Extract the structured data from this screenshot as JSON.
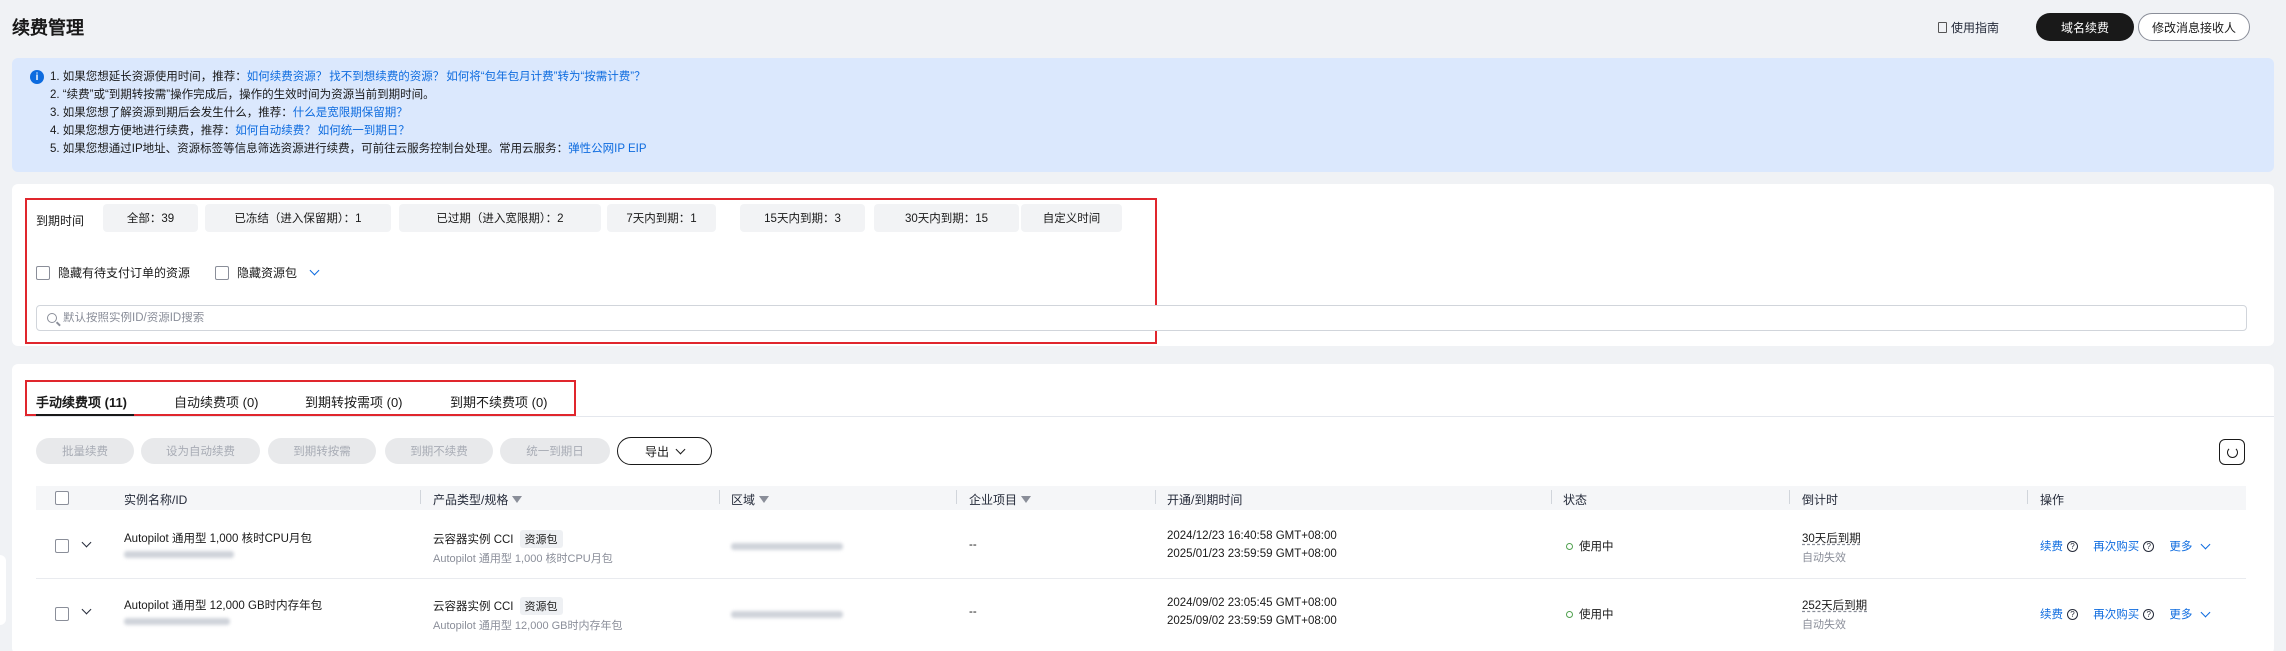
{
  "header": {
    "title": "续费管理",
    "guide_label": "使用指南",
    "primary_button": "域名续费",
    "outline_button": "修改消息接收人"
  },
  "notice": {
    "lines": [
      {
        "prefix": "1. 如果您想延长资源使用时间，推荐：",
        "links": [
          "如何续费资源？",
          "找不到想续费的资源？",
          "如何将“包年包月计费”转为“按需计费”？"
        ],
        "suffix": ""
      },
      {
        "prefix": "2. “续费”或“到期转按需”操作完成后，操作的生效时间为资源当前到期时间。",
        "links": [],
        "suffix": ""
      },
      {
        "prefix": "3. 如果您想了解资源到期后会发生什么，推荐：",
        "links": [
          "什么是宽限期保留期？"
        ],
        "suffix": ""
      },
      {
        "prefix": "4. 如果您想方便地进行续费，推荐：",
        "links": [
          "如何自动续费？",
          "如何统一到期日？"
        ],
        "suffix": ""
      },
      {
        "prefix": "5. 如果您想通过IP地址、资源标签等信息筛选资源进行续费，可前往云服务控制台处理。常用云服务：",
        "links": [
          "弹性公网IP EIP"
        ],
        "suffix": ""
      }
    ]
  },
  "filter": {
    "label": "到期时间",
    "chips": [
      "全部：39",
      "已冻结（进入保留期）：1",
      "已过期（进入宽限期）：2",
      "7天内到期：1",
      "15天内到期：3",
      "30天内到期：15",
      "自定义时间"
    ],
    "checkbox1": "隐藏有待支付订单的资源",
    "checkbox2": "隐藏资源包",
    "search_placeholder": "默认按照实例ID/资源ID搜索"
  },
  "tabs": [
    "手动续费项 (11)",
    "自动续费项 (0)",
    "到期转按需项 (0)",
    "到期不续费项 (0)"
  ],
  "actions": [
    "批量续费",
    "设为自动续费",
    "到期转按需",
    "到期不续费",
    "统一到期日"
  ],
  "export_label": "导出",
  "table": {
    "columns": [
      "实例名称/ID",
      "产品类型/规格",
      "区域",
      "企业项目",
      "开通/到期时间",
      "状态",
      "倒计时",
      "操作"
    ],
    "rows": [
      {
        "name": "Autopilot 通用型 1,000 核时CPU月包",
        "product": "云容器实例 CCI",
        "tag": "资源包",
        "spec": "Autopilot 通用型 1,000 核时CPU月包",
        "project": "--",
        "start": "2024/12/23 16:40:58 GMT+08:00",
        "end": "2025/01/23 23:59:59 GMT+08:00",
        "status": "使用中",
        "countdown": "30天后到期",
        "countdown_sub": "自动失效",
        "op_renew": "续费",
        "op_rebuy": "再次购买",
        "op_more": "更多"
      },
      {
        "name": "Autopilot 通用型 12,000 GB时内存年包",
        "product": "云容器实例 CCI",
        "tag": "资源包",
        "spec": "Autopilot 通用型 12,000 GB时内存年包",
        "project": "--",
        "start": "2024/09/02 23:05:45 GMT+08:00",
        "end": "2025/09/02 23:59:59 GMT+08:00",
        "status": "使用中",
        "countdown": "252天后到期",
        "countdown_sub": "自动失效",
        "op_renew": "续费",
        "op_rebuy": "再次购买",
        "op_more": "更多"
      }
    ]
  },
  "colors": {
    "accent": "#0d6bdf",
    "highlight_border": "#e0262d",
    "status_ok": "#50a14f",
    "notice_bg": "#dbe8fd"
  }
}
